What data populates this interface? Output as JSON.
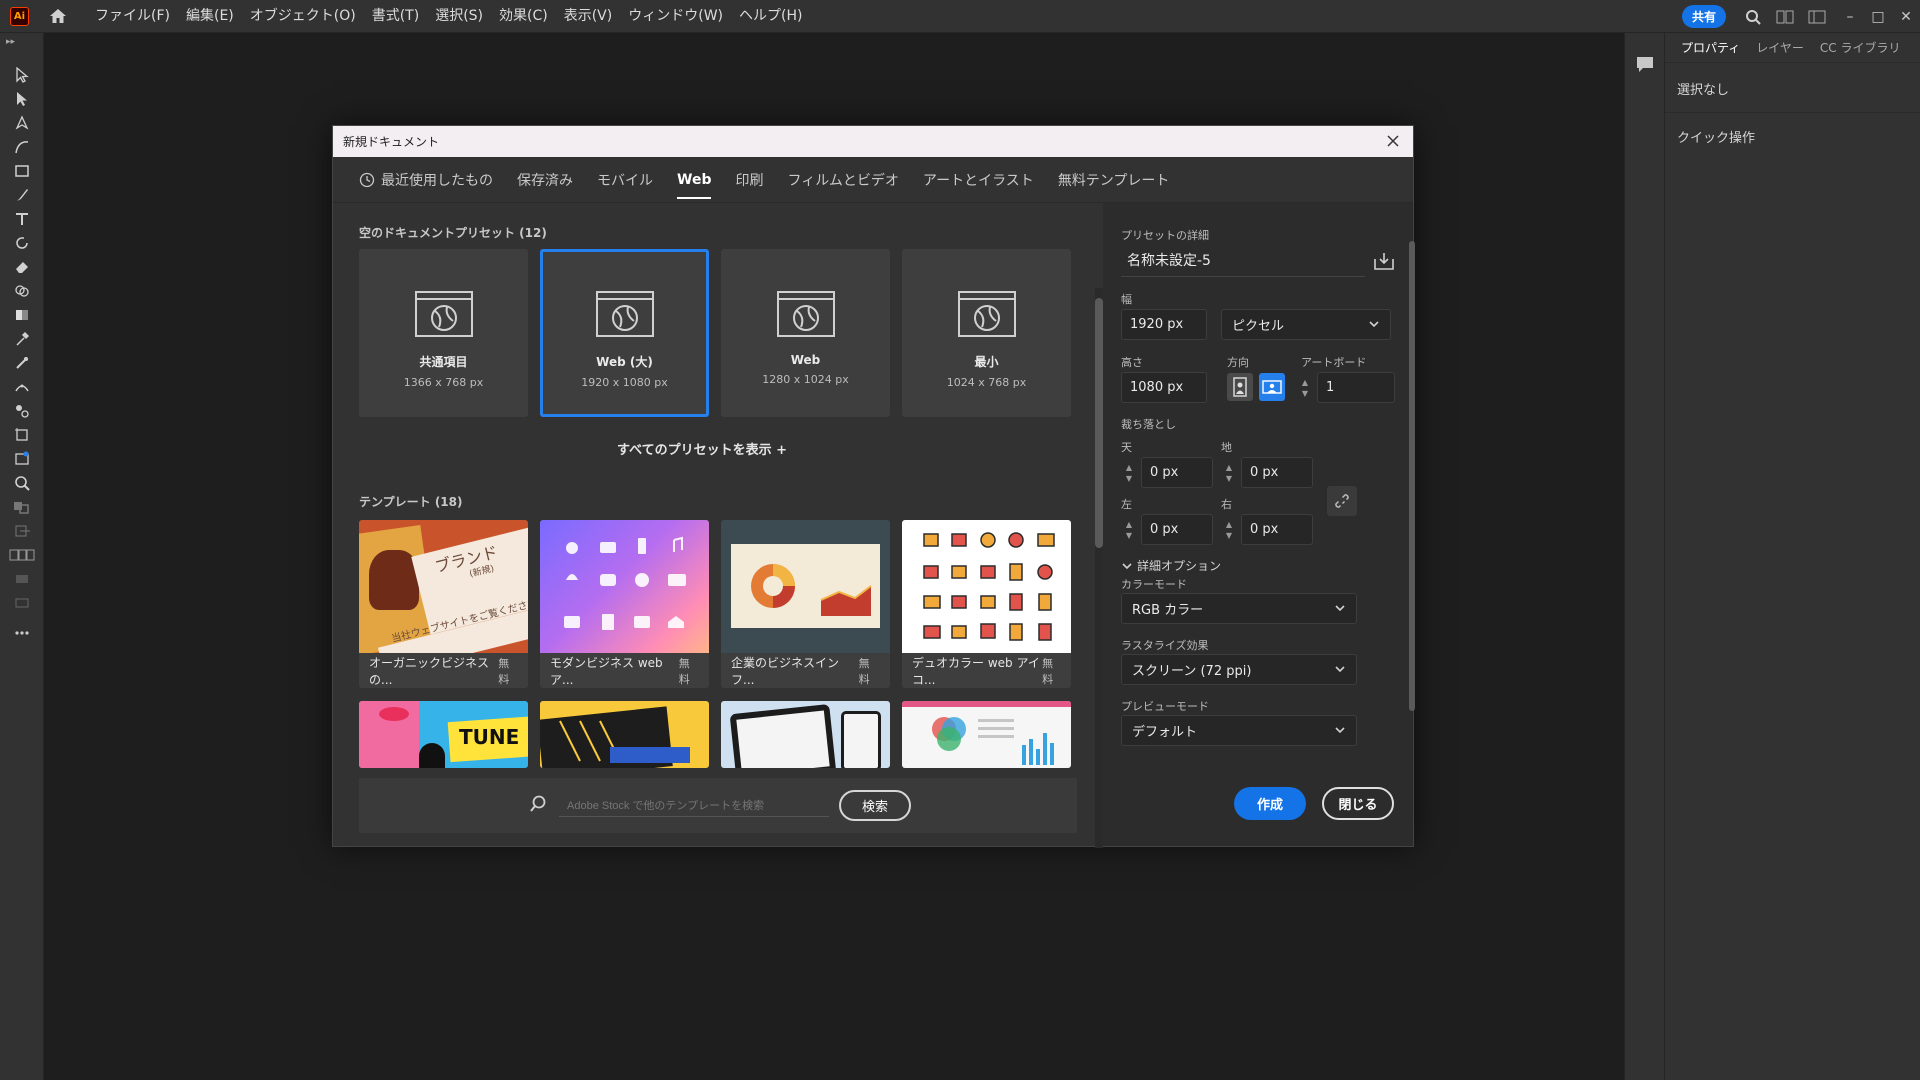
{
  "app": {
    "logo": "Ai"
  },
  "menu": [
    "ファイル(F)",
    "編集(E)",
    "オブジェクト(O)",
    "書式(T)",
    "選択(S)",
    "効果(C)",
    "表示(V)",
    "ウィンドウ(W)",
    "ヘルプ(H)"
  ],
  "topbar": {
    "share_label": "共有",
    "minimize": "–",
    "maximize": "□",
    "close": "✕"
  },
  "panel": {
    "tabs": [
      "プロパティ",
      "レイヤー",
      "CC ライブラリ"
    ],
    "no_selection": "選択なし",
    "quick_actions": "クイック操作"
  },
  "dialog": {
    "title": "新規ドキュメント",
    "tabs": [
      "最近使用したもの",
      "保存済み",
      "モバイル",
      "Web",
      "印刷",
      "フィルムとビデオ",
      "アートとイラスト",
      "無料テンプレート"
    ],
    "active_tab": "Web",
    "presets_label": "空のドキュメントプリセット (12)",
    "presets": [
      {
        "name": "共通項目",
        "size": "1366 x 768 px"
      },
      {
        "name": "Web (大)",
        "size": "1920 x 1080 px"
      },
      {
        "name": "Web",
        "size": "1280 x 1024 px"
      },
      {
        "name": "最小",
        "size": "1024 x 768 px"
      }
    ],
    "show_all": "すべてのプリセットを表示 +",
    "templates_label": "テンプレート (18)",
    "templates": [
      {
        "name": "オーガニックビジネスの...",
        "price": "無料"
      },
      {
        "name": "モダンビジネス web ア...",
        "price": "無料"
      },
      {
        "name": "企業のビジネスインフ...",
        "price": "無料"
      },
      {
        "name": "デュオカラー web アイコ...",
        "price": "無料"
      }
    ],
    "thumb_text": {
      "brand": "ブランド",
      "shinki": "(新規)",
      "site": "当社ウェブサイトをご覧ください",
      "tune": "TUNE"
    },
    "search_placeholder": "Adobe Stock で他のテンプレートを検索",
    "search_button": "検索",
    "details": {
      "header": "プリセットの詳細",
      "doc_name": "名称未設定-5",
      "width_label": "幅",
      "width_value": "1920 px",
      "unit": "ピクセル",
      "height_label": "高さ",
      "height_value": "1080 px",
      "orientation_label": "方向",
      "artboard_label": "アートボード",
      "artboard_value": "1",
      "bleed_label": "裁ち落とし",
      "top_label": "天",
      "top_value": "0 px",
      "bottom_label": "地",
      "bottom_value": "0 px",
      "left_label": "左",
      "left_value": "0 px",
      "right_label": "右",
      "right_value": "0 px",
      "advanced_label": "詳細オプション",
      "color_mode_label": "カラーモード",
      "color_mode_value": "RGB カラー",
      "raster_label": "ラスタライズ効果",
      "raster_value": "スクリーン (72 ppi)",
      "preview_label": "プレビューモード",
      "preview_value": "デフォルト"
    },
    "create_button": "作成",
    "close_button": "閉じる"
  }
}
